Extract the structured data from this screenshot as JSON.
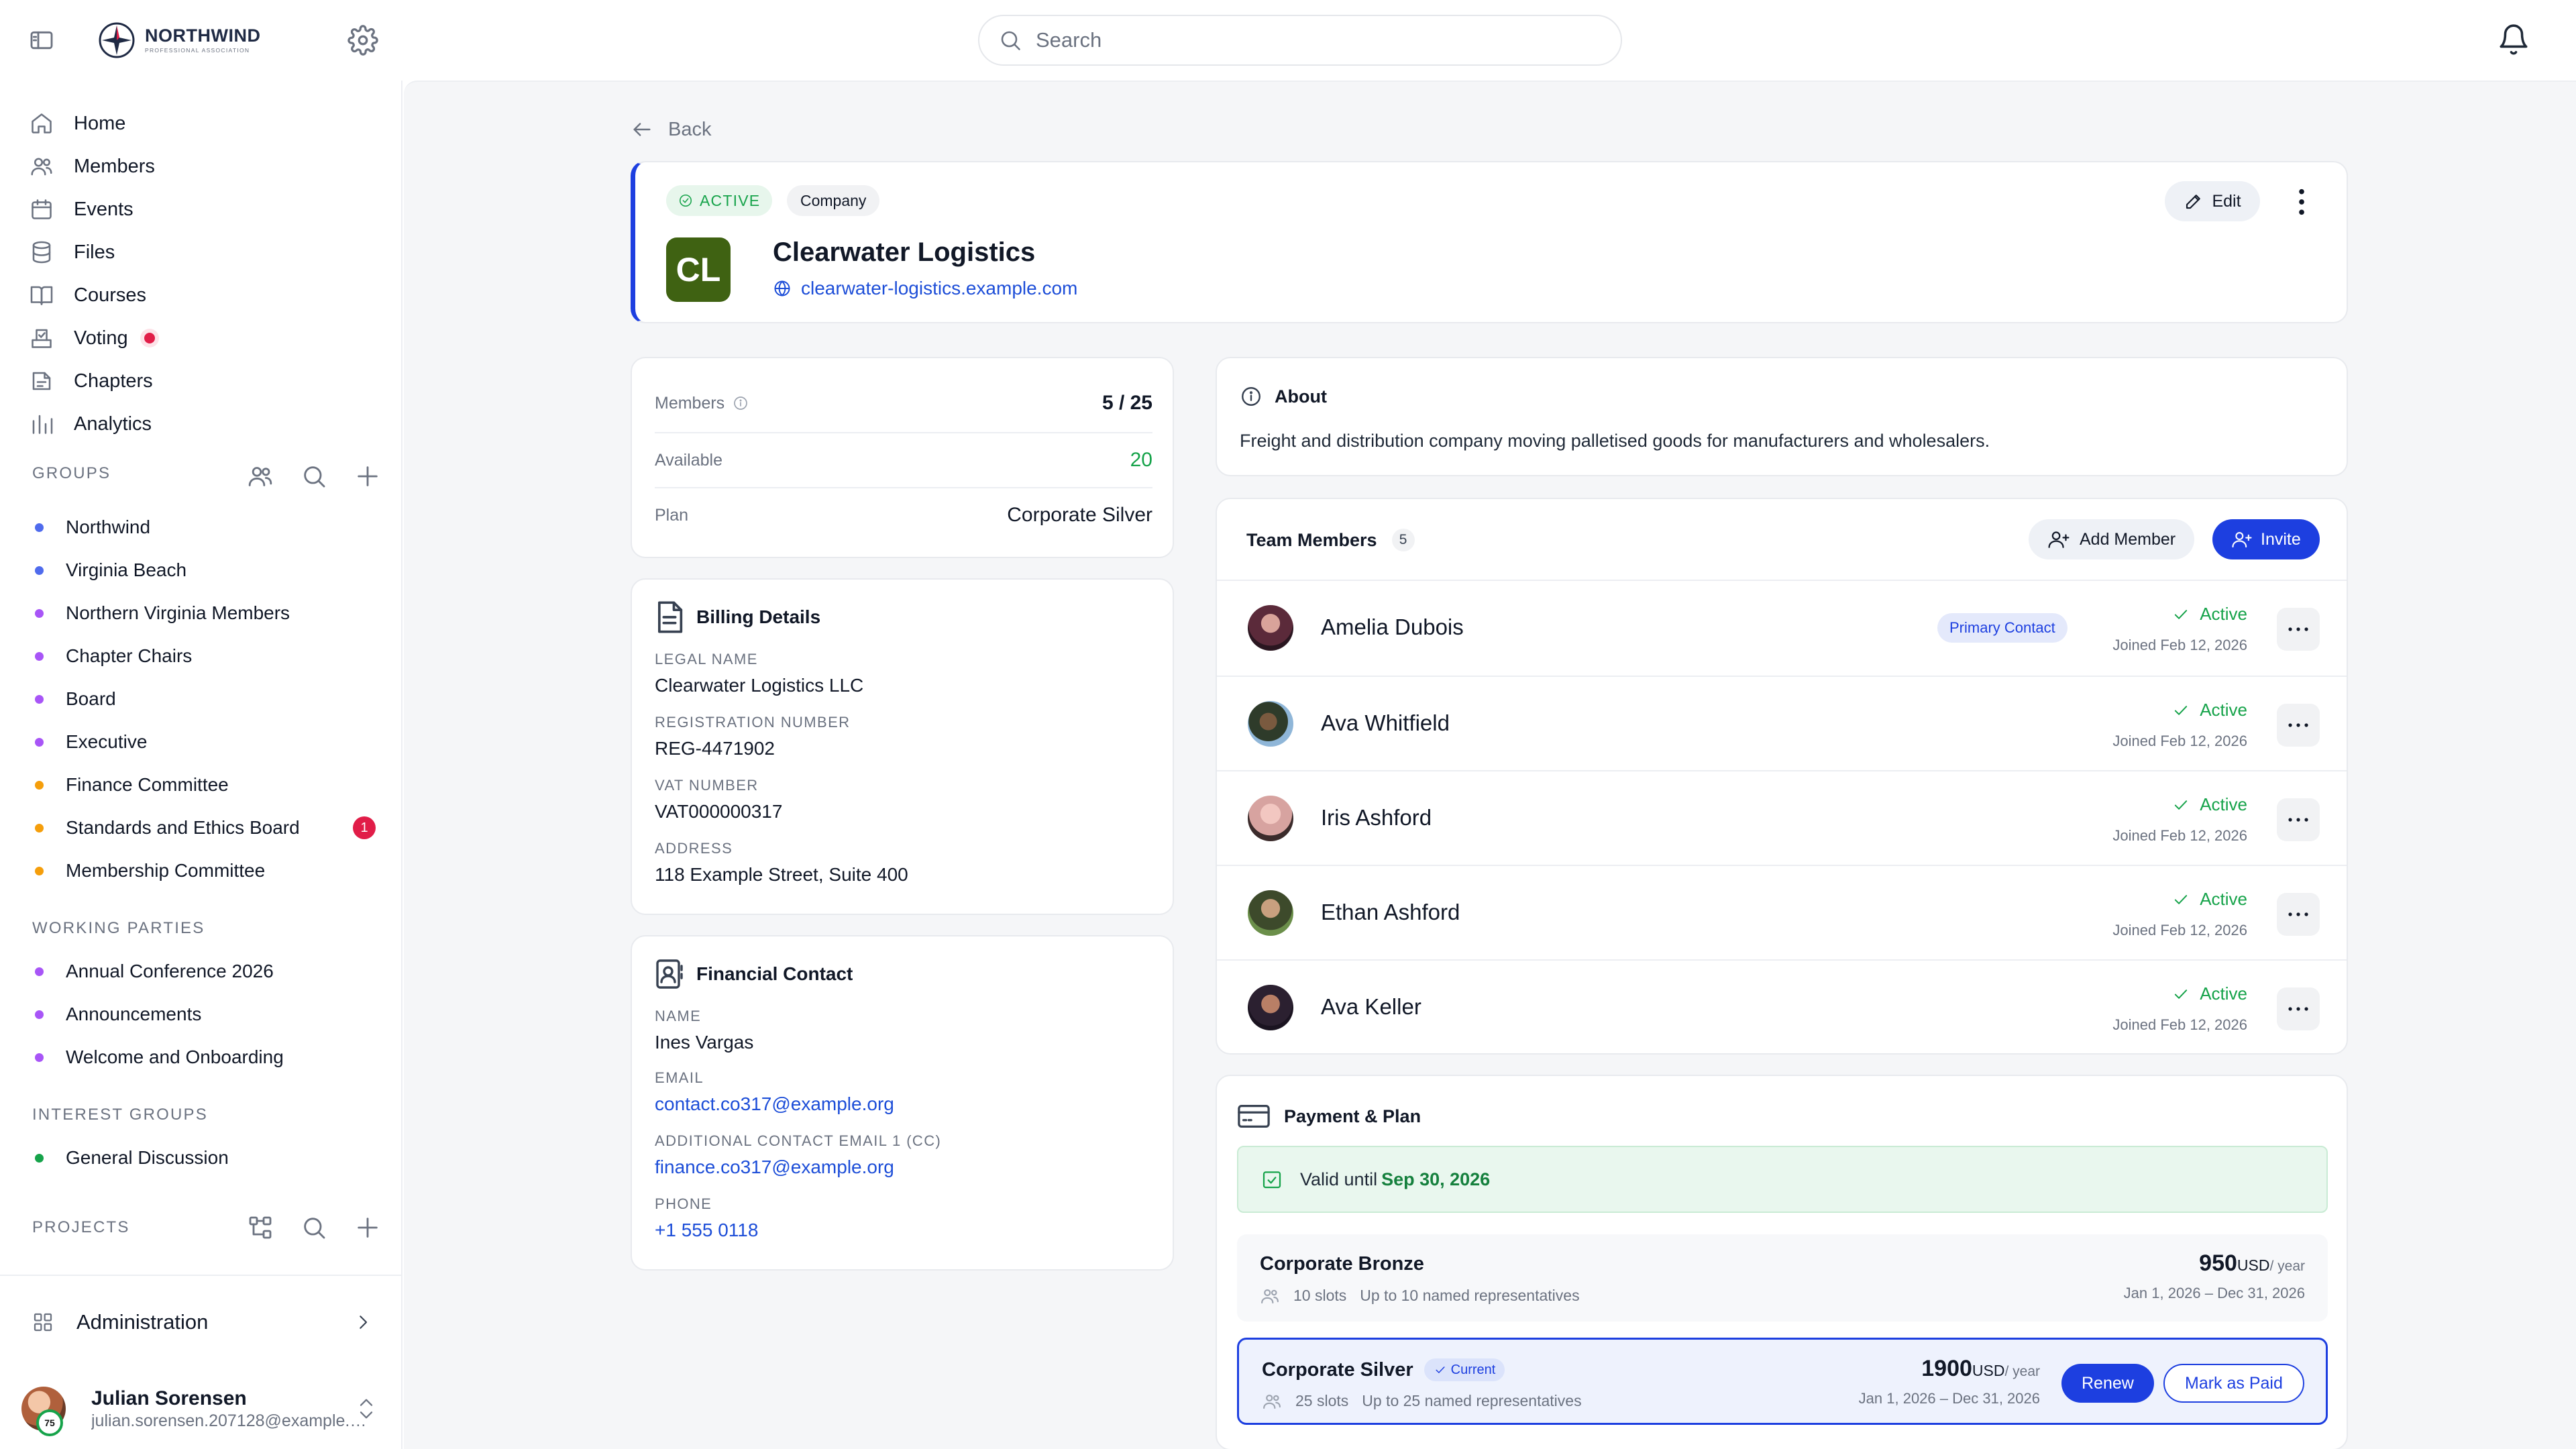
{
  "app": {
    "logo_name": "NORTHWIND",
    "logo_subtitle": "PROFESSIONAL ASSOCIATION",
    "search_placeholder": "Search"
  },
  "sidebar": {
    "nav": [
      {
        "label": "Home",
        "icon": "home-icon"
      },
      {
        "label": "Members",
        "icon": "members-icon"
      },
      {
        "label": "Events",
        "icon": "calendar-icon"
      },
      {
        "label": "Files",
        "icon": "database-icon"
      },
      {
        "label": "Courses",
        "icon": "book-icon"
      },
      {
        "label": "Voting",
        "icon": "ballot-icon"
      },
      {
        "label": "Chapters",
        "icon": "chapters-icon"
      },
      {
        "label": "Analytics",
        "icon": "chart-icon"
      }
    ],
    "groups_label": "GROUPS",
    "groups": [
      {
        "label": "Northwind",
        "color": "#4f6bed"
      },
      {
        "label": "Virginia Beach",
        "color": "#4f6bed"
      },
      {
        "label": "Northern Virginia Members",
        "color": "#a855f7"
      },
      {
        "label": "Chapter Chairs",
        "color": "#a855f7"
      },
      {
        "label": "Board",
        "color": "#a855f7"
      },
      {
        "label": "Executive",
        "color": "#a855f7"
      },
      {
        "label": "Finance Committee",
        "color": "#f59e0b"
      },
      {
        "label": "Standards and Ethics Board",
        "color": "#f59e0b",
        "badge": "1"
      },
      {
        "label": "Membership Committee",
        "color": "#f59e0b"
      }
    ],
    "working_parties_label": "WORKING PARTIES",
    "working_parties": [
      {
        "label": "Annual Conference 2026",
        "color": "#a855f7"
      },
      {
        "label": "Announcements",
        "color": "#a855f7"
      },
      {
        "label": "Welcome and Onboarding",
        "color": "#a855f7"
      }
    ],
    "interest_groups_label": "INTEREST GROUPS",
    "interest_groups": [
      {
        "label": "General Discussion",
        "color": "#16a34a"
      }
    ],
    "projects_label": "PROJECTS",
    "admin_label": "Administration",
    "user": {
      "name": "Julian Sorensen",
      "email": "julian.sorensen.207128@example.org",
      "badge": "75"
    }
  },
  "main": {
    "back_label": "Back",
    "org": {
      "status": "ACTIVE",
      "type": "Company",
      "initials": "CL",
      "name": "Clearwater Logistics",
      "website": "clearwater-logistics.example.com",
      "edit_label": "Edit"
    },
    "stats": [
      {
        "label": "Members",
        "value": "5 / 25"
      },
      {
        "label": "Available",
        "value": "20"
      },
      {
        "label": "Plan",
        "value": "Corporate Silver"
      }
    ],
    "billing": {
      "title": "Billing Details",
      "fields": [
        {
          "label": "LEGAL NAME",
          "value": "Clearwater Logistics LLC"
        },
        {
          "label": "REGISTRATION NUMBER",
          "value": "REG-4471902"
        },
        {
          "label": "VAT NUMBER",
          "value": "VAT000000317"
        },
        {
          "label": "ADDRESS",
          "value": "118 Example Street, Suite 400"
        }
      ]
    },
    "financial_contact": {
      "title": "Financial Contact",
      "fields": [
        {
          "label": "NAME",
          "value": "Ines Vargas"
        },
        {
          "label": "EMAIL",
          "value": "contact.co317@example.org"
        },
        {
          "label": "ADDITIONAL CONTACT EMAIL 1 (CC)",
          "value": "finance.co317@example.org"
        },
        {
          "label": "PHONE",
          "value": "+1 555 0118"
        }
      ]
    },
    "about": {
      "title": "About",
      "text": "Freight and distribution company moving palletised goods for manufacturers and wholesalers."
    },
    "team": {
      "title": "Team Members",
      "count": "5",
      "add_label": "Add Member",
      "invite_label": "Invite",
      "primary_label": "Primary Contact",
      "members": [
        {
          "name": "Amelia Dubois",
          "status": "Active",
          "joined": "Joined Feb 12, 2026",
          "primary": true
        },
        {
          "name": "Ava Whitfield",
          "status": "Active",
          "joined": "Joined Feb 12, 2026"
        },
        {
          "name": "Iris Ashford",
          "status": "Active",
          "joined": "Joined Feb 12, 2026"
        },
        {
          "name": "Ethan Ashford",
          "status": "Active",
          "joined": "Joined Feb 12, 2026"
        },
        {
          "name": "Ava Keller",
          "status": "Active",
          "joined": "Joined Feb 12, 2026"
        }
      ]
    },
    "payment": {
      "title": "Payment & Plan",
      "valid_prefix": "Valid until",
      "valid_date": "Sep 30, 2026",
      "current_label": "Current",
      "renew_label": "Renew",
      "mark_paid_label": "Mark as Paid",
      "plans": [
        {
          "name": "Corporate Bronze",
          "slots": "10 slots",
          "desc": "Up to 10 named representatives",
          "price": "950",
          "currency": "USD",
          "period": "/ year",
          "dates": "Jan 1, 2026 – Dec 31, 2026"
        },
        {
          "name": "Corporate Silver",
          "slots": "25 slots",
          "desc": "Up to 25 named representatives",
          "price": "1900",
          "currency": "USD",
          "period": "/ year",
          "dates": "Jan 1, 2026 – Dec 31, 2026",
          "current": true
        }
      ]
    }
  }
}
